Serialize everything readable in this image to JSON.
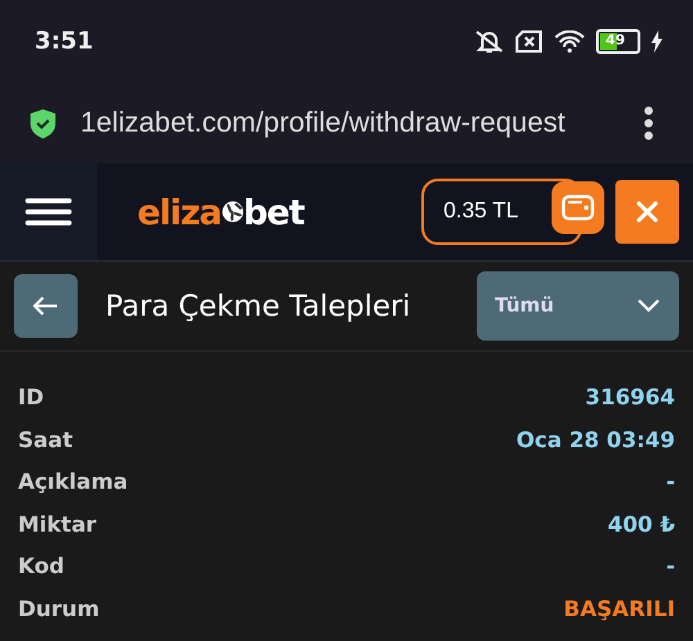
{
  "status_bar": {
    "time": "3:51",
    "battery": "49"
  },
  "browser": {
    "url": "1elizabet.com/profile/withdraw-request"
  },
  "header": {
    "logo": {
      "accent": "eliza",
      "rest": "bet"
    },
    "balance": "0.35 TL"
  },
  "page": {
    "title": "Para Çekme Talepleri",
    "filter": "Tümü"
  },
  "details": [
    {
      "label": "ID",
      "value": "316964",
      "kind": "info"
    },
    {
      "label": "Saat",
      "value": "Oca 28 03:49",
      "kind": "info"
    },
    {
      "label": "Açıklama",
      "value": "-",
      "kind": "info"
    },
    {
      "label": "Miktar",
      "value": "400 ₺",
      "kind": "info"
    },
    {
      "label": "Kod",
      "value": "-",
      "kind": "info"
    },
    {
      "label": "Durum",
      "value": "BAŞARILI",
      "kind": "status"
    }
  ]
}
